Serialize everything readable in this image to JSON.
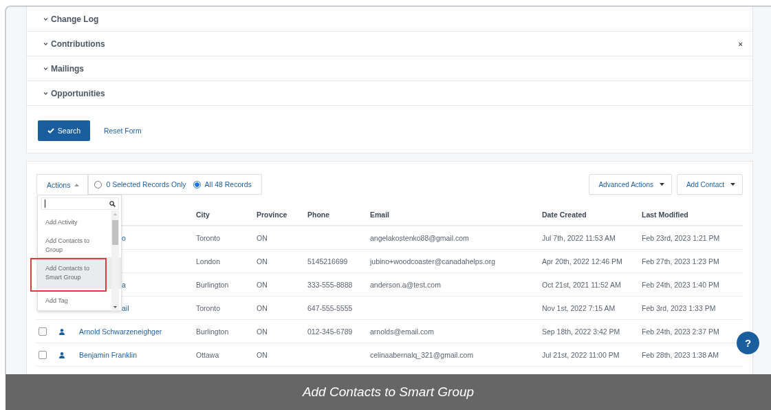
{
  "accordion": [
    {
      "label": "Change Log",
      "expanded": false
    },
    {
      "label": "Contributions",
      "expanded": false,
      "close": "×"
    },
    {
      "label": "Mailings",
      "expanded": false
    },
    {
      "label": "Opportunities",
      "expanded": false
    }
  ],
  "search_form": {
    "search_button": "Search",
    "reset_link": "Reset Form"
  },
  "results": {
    "actions": {
      "label": "Actions",
      "open": true,
      "items": [
        {
          "label": "Add Activity",
          "selected": false
        },
        {
          "label": "Add Contacts to Group",
          "selected": false
        },
        {
          "label": "Add Contacts to Smart Group",
          "selected": true
        },
        {
          "label": "Add Tag",
          "selected": false
        }
      ]
    },
    "record_scope": [
      {
        "label": "0 Selected Records Only",
        "selected": false
      },
      {
        "label": "All 48 Records",
        "selected": true
      }
    ],
    "buttons": [
      "Advanced Actions",
      "Add Contact"
    ],
    "table": {
      "columns": [
        "City",
        "Province",
        "Phone",
        "Email",
        "Date Created",
        "Last Modified"
      ],
      "rows": [
        {
          "kind": "covered",
          "name": "o",
          "cells": [
            "Toronto",
            "ON",
            "",
            "angelakostenko88@gmail.com",
            "Jul 7th, 2022 11:53 AM",
            "Feb 23rd, 2023 1:21 PM"
          ]
        },
        {
          "kind": "covered",
          "cells": [
            "London",
            "ON",
            "5145216699",
            "jubino+woodcoaster@canadahelps.org",
            "Apr 20th, 2022 12:46 PM",
            "Feb 27th, 2023 1:23 PM"
          ]
        },
        {
          "kind": "covered",
          "name": "a",
          "cells": [
            "Burlington",
            "ON",
            "333-555-8888",
            "anderson.a@test.com",
            "Oct 21st, 2021 11:52 AM",
            "Feb 24th, 2023 1:40 PM"
          ]
        },
        {
          "kind": "covered",
          "name": "ail",
          "cells": [
            "Toronto",
            "ON",
            "647-555-5555",
            "",
            "Nov 1st, 2022 7:15 AM",
            "Feb 3rd, 2023 1:33 PM"
          ]
        },
        {
          "kind": "contact",
          "checked": false,
          "name": "Arnold Schwarzeneighger",
          "cells": [
            "Burlington",
            "ON",
            "012-345-6789",
            "arnolds@email.com",
            "Sep 18th, 2022 3:42 PM",
            "Feb 24th, 2023 2:37 PM"
          ]
        },
        {
          "kind": "contact",
          "checked": false,
          "name": "Benjamin Franklin",
          "cells": [
            "Ottawa",
            "ON",
            "",
            "celinaabernalq_321@gmail.com",
            "Jul 21st, 2022 11:00 PM",
            "Feb 28th, 2023 1:38 AM"
          ]
        }
      ]
    }
  },
  "help_button": "?",
  "caption": "Add Contacts to Smart Group"
}
